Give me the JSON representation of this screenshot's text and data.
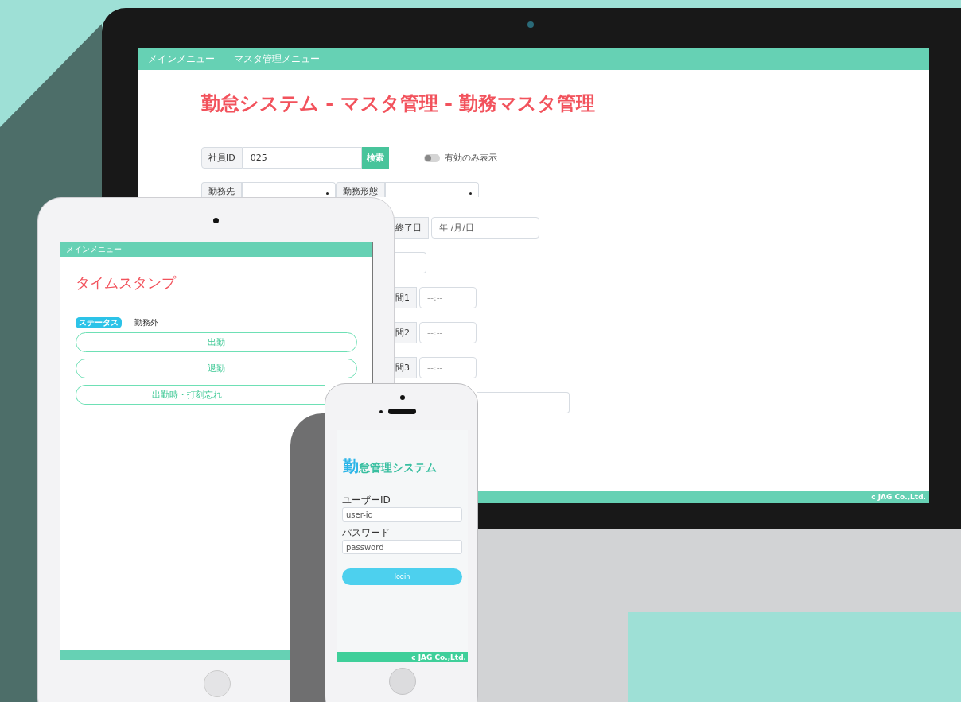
{
  "monitor": {
    "nav": [
      "メインメニュー",
      "マスタ管理メニュー"
    ],
    "title": "勤怠システム - マスタ管理 - 勤務マスタ管理",
    "employee_id": {
      "label": "社員ID",
      "value": "025",
      "button": "検索"
    },
    "active_only_toggle": {
      "label": "有効のみ表示",
      "on": false
    },
    "workplace": {
      "label": "勤務先"
    },
    "work_type": {
      "label": "勤務形態"
    },
    "end_date": {
      "label": "終了日",
      "placeholder": "年 /月/日"
    },
    "breaks": [
      {
        "label": "間1",
        "placeholder": "--:--"
      },
      {
        "label": "間2",
        "placeholder": "--:--"
      },
      {
        "label": "間3",
        "placeholder": "--:--"
      }
    ],
    "footer": "c JAG Co.,Ltd."
  },
  "tablet": {
    "nav": "メインメニュー",
    "title": "タイムスタンプ",
    "status": {
      "badge": "ステータス",
      "value": "勤務外"
    },
    "buttons": [
      "出勤",
      "退勤",
      "出勤時・打刻忘れ"
    ]
  },
  "phone": {
    "title_first": "勤",
    "title_rest": "怠管理システム",
    "fields": [
      {
        "label": "ユーザーID",
        "value": "user-id"
      },
      {
        "label": "パスワード",
        "value": "password"
      }
    ],
    "button": "login",
    "footer": "c JAG Co.,Ltd."
  }
}
